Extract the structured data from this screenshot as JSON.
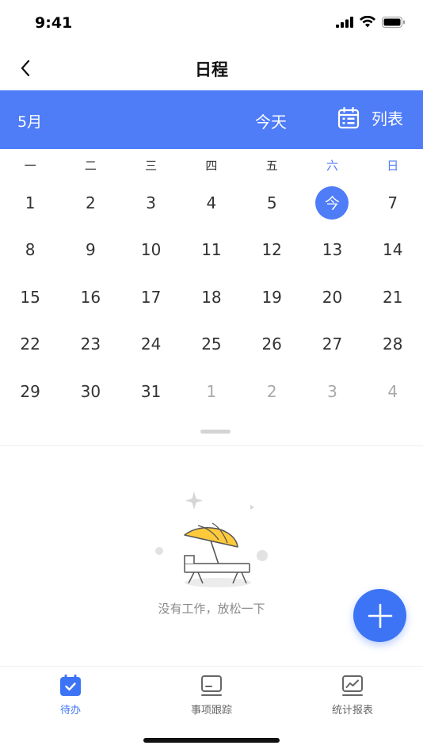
{
  "status_bar": {
    "time": "9:41"
  },
  "nav": {
    "title": "日程"
  },
  "toolbar": {
    "month": "5月",
    "today_label": "今天",
    "list_label": "列表"
  },
  "weekdays": [
    "一",
    "二",
    "三",
    "四",
    "五",
    "六",
    "日"
  ],
  "calendar": {
    "rows": [
      [
        {
          "label": "1",
          "muted": false
        },
        {
          "label": "2",
          "muted": false
        },
        {
          "label": "3",
          "muted": false
        },
        {
          "label": "4",
          "muted": false
        },
        {
          "label": "5",
          "muted": false
        },
        {
          "label": "今",
          "muted": false,
          "today": true
        },
        {
          "label": "7",
          "muted": false
        }
      ],
      [
        {
          "label": "8",
          "muted": false
        },
        {
          "label": "9",
          "muted": false
        },
        {
          "label": "10",
          "muted": false
        },
        {
          "label": "11",
          "muted": false
        },
        {
          "label": "12",
          "muted": false
        },
        {
          "label": "13",
          "muted": false
        },
        {
          "label": "14",
          "muted": false
        }
      ],
      [
        {
          "label": "15",
          "muted": false
        },
        {
          "label": "16",
          "muted": false
        },
        {
          "label": "17",
          "muted": false
        },
        {
          "label": "18",
          "muted": false
        },
        {
          "label": "19",
          "muted": false
        },
        {
          "label": "20",
          "muted": false
        },
        {
          "label": "21",
          "muted": false
        }
      ],
      [
        {
          "label": "22",
          "muted": false
        },
        {
          "label": "23",
          "muted": false
        },
        {
          "label": "24",
          "muted": false
        },
        {
          "label": "25",
          "muted": false
        },
        {
          "label": "26",
          "muted": false
        },
        {
          "label": "27",
          "muted": false
        },
        {
          "label": "28",
          "muted": false
        }
      ],
      [
        {
          "label": "29",
          "muted": false
        },
        {
          "label": "30",
          "muted": false
        },
        {
          "label": "31",
          "muted": false
        },
        {
          "label": "1",
          "muted": true
        },
        {
          "label": "2",
          "muted": true
        },
        {
          "label": "3",
          "muted": true
        },
        {
          "label": "4",
          "muted": true
        }
      ]
    ]
  },
  "empty_state": {
    "text": "没有工作，放松一下"
  },
  "tabs": [
    {
      "label": "待办",
      "icon": "todo-calendar-icon",
      "active": true
    },
    {
      "label": "事项跟踪",
      "icon": "tracking-monitor-icon",
      "active": false
    },
    {
      "label": "统计报表",
      "icon": "report-chart-icon",
      "active": false
    }
  ],
  "colors": {
    "accent": "#4f7cf7",
    "fab": "#3d74f5",
    "muted_text": "#a9a9a9"
  }
}
